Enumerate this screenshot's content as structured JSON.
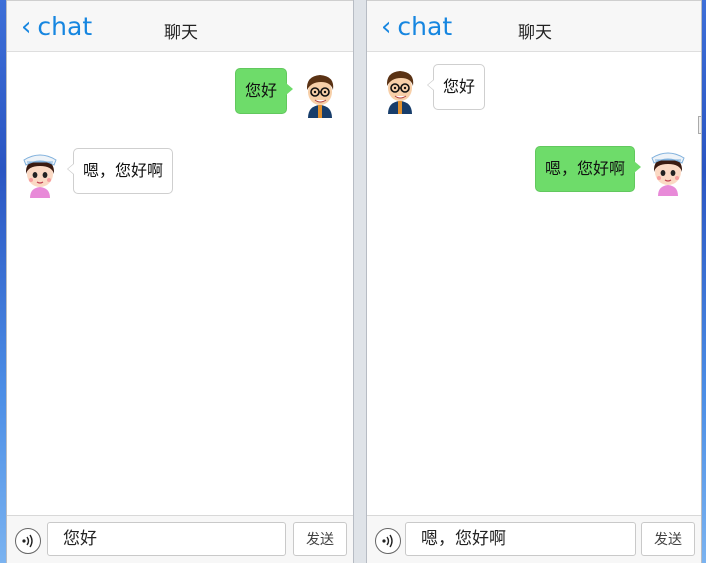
{
  "windows": [
    {
      "back_label": "chat",
      "title": "聊天",
      "messages": [
        {
          "sender": "me",
          "avatar": "boy-avatar",
          "text": "您好"
        },
        {
          "sender": "other",
          "avatar": "nurse-avatar",
          "text": "嗯，您好啊"
        }
      ],
      "input_value": "您好",
      "send_label": "发送"
    },
    {
      "back_label": "chat",
      "title": "聊天",
      "messages": [
        {
          "sender": "other",
          "avatar": "boy-avatar",
          "text": "您好"
        },
        {
          "sender": "me",
          "avatar": "nurse-avatar",
          "text": "嗯，您好啊"
        }
      ],
      "input_value": "嗯，您好啊",
      "send_label": "发送"
    }
  ],
  "colors": {
    "accent": "#1686e0",
    "bubble_me": "#6edc6a",
    "bubble_other": "#ffffff"
  }
}
